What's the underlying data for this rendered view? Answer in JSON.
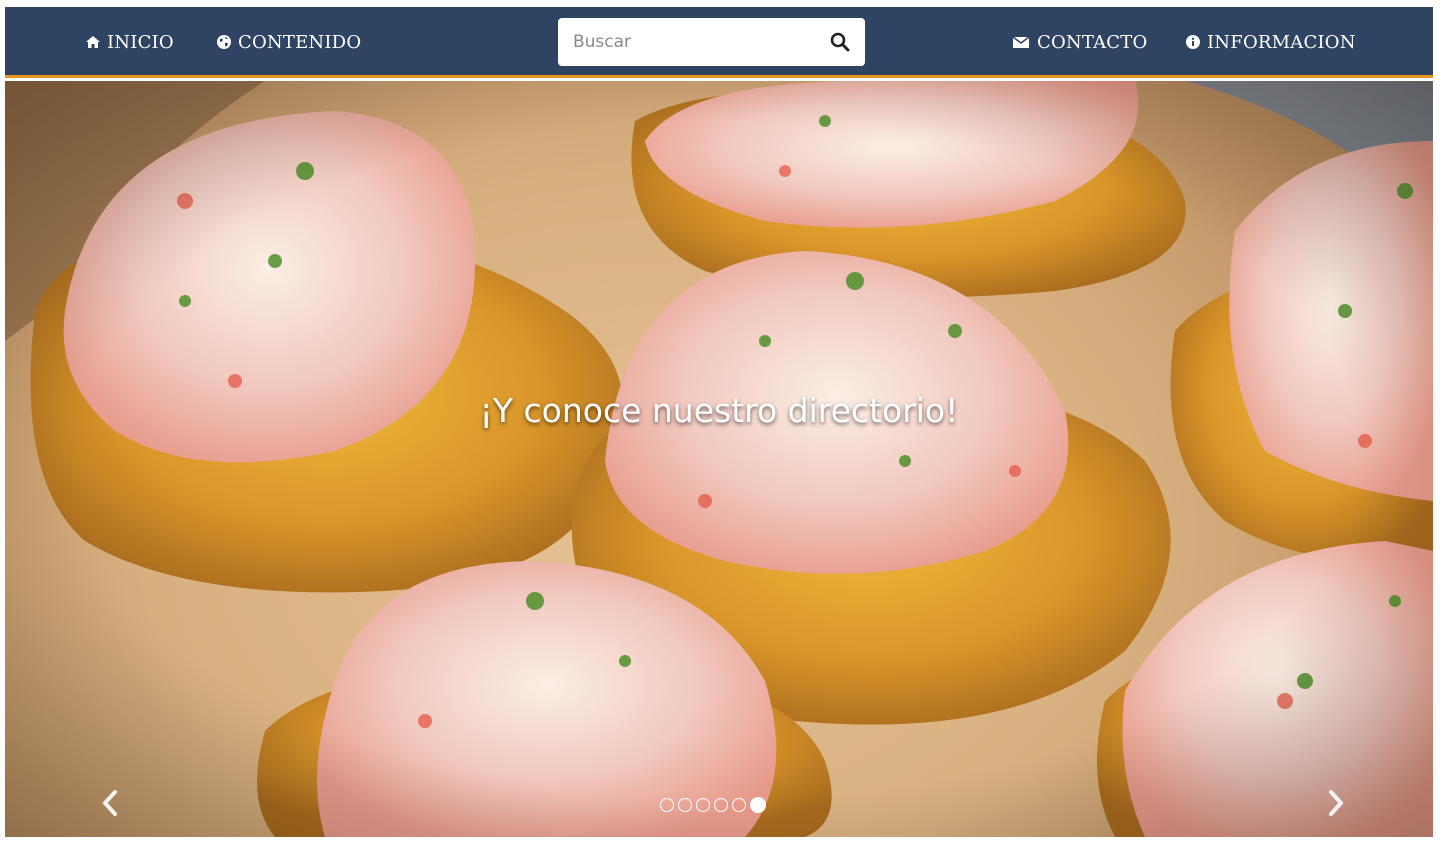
{
  "navbar": {
    "home_label": "INICIO",
    "content_label": "CONTENIDO",
    "contact_label": "CONTACTO",
    "info_label": "INFORMACION",
    "search": {
      "placeholder": "Buscar",
      "value": ""
    }
  },
  "hero": {
    "caption": "¡Y conoce nuestro directorio!",
    "slide_count": 6,
    "active_slide": 6
  },
  "icons": {
    "home": "home-icon",
    "content": "globe-icon",
    "contact": "envelope-icon",
    "info": "info-icon",
    "search": "search-icon",
    "prev": "chevron-left-icon",
    "next": "chevron-right-icon"
  },
  "colors": {
    "navbar_bg": "#2e4462",
    "navbar_border": "#e8931e",
    "text_light": "#ffffff"
  }
}
